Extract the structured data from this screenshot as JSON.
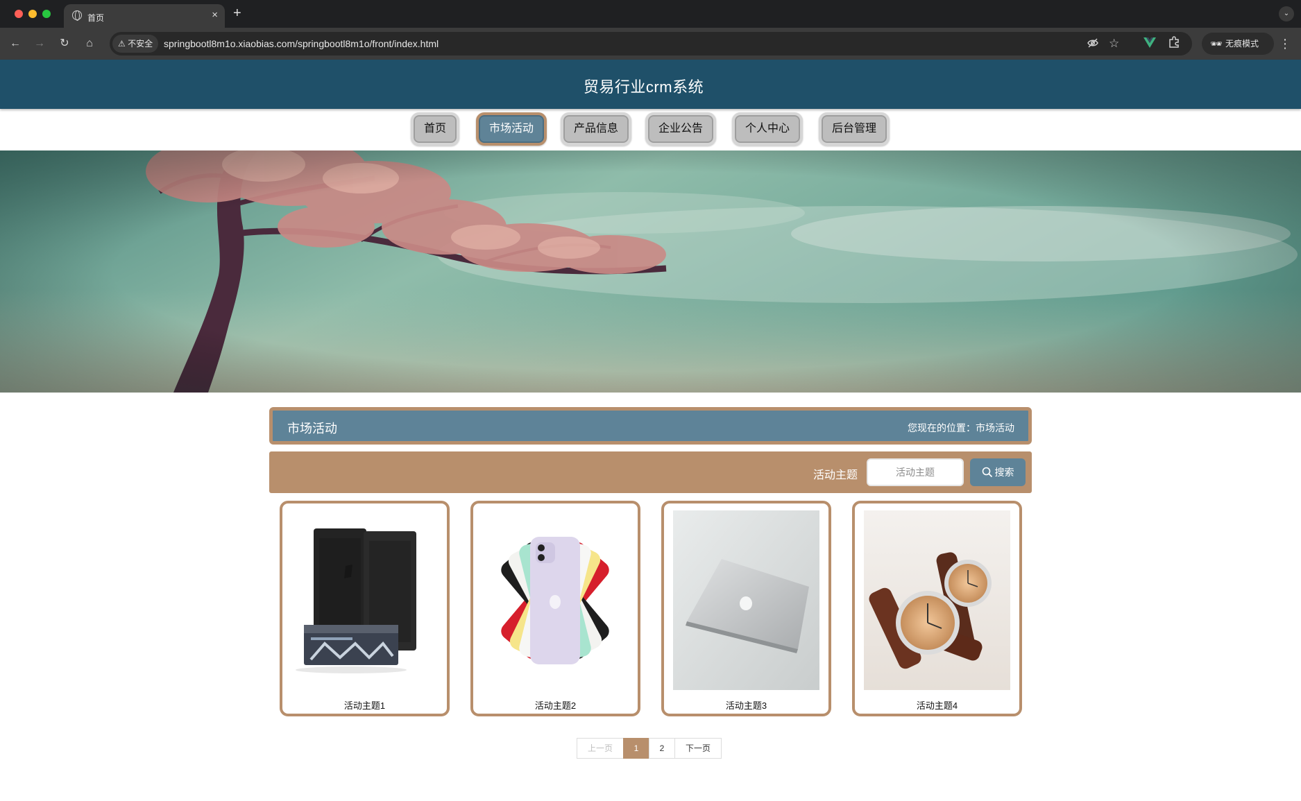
{
  "browser": {
    "tab_title": "首页",
    "tab_close": "×",
    "new_tab": "+",
    "security_label": "不安全",
    "url": "springbootl8m1o.xiaobias.com/springbootl8m1o/front/index.html",
    "incognito_label": "无痕模式",
    "icons": [
      "back-icon",
      "forward-icon",
      "reload-icon",
      "home-icon",
      "warning-icon",
      "eye-off-icon",
      "star-icon",
      "vue-devtools-icon",
      "extensions-icon",
      "incognito-icon",
      "menu-icon"
    ]
  },
  "site": {
    "title": "贸易行业crm系统",
    "nav": [
      "首页",
      "市场活动",
      "产品信息",
      "企业公告",
      "个人中心",
      "后台管理"
    ],
    "active_nav": "市场活动"
  },
  "section": {
    "title": "市场活动",
    "location": "您现在的位置：市场活动"
  },
  "search": {
    "label": "活动主题",
    "placeholder": "活动主题",
    "button": "搜索"
  },
  "cards": [
    {
      "title": "活动主题1",
      "image": "speakers-amplifier-photo"
    },
    {
      "title": "活动主题2",
      "image": "iphone-colors-photo"
    },
    {
      "title": "活动主题3",
      "image": "macbook-photo"
    },
    {
      "title": "活动主题4",
      "image": "wristwatches-photo"
    }
  ],
  "pagination": {
    "prev": "上一页",
    "pages": [
      "1",
      "2"
    ],
    "current": "1",
    "next": "下一页"
  },
  "colors": {
    "header": "#1f5069",
    "accent_brown": "#b88f6c",
    "steel_blue": "#5e8398"
  }
}
